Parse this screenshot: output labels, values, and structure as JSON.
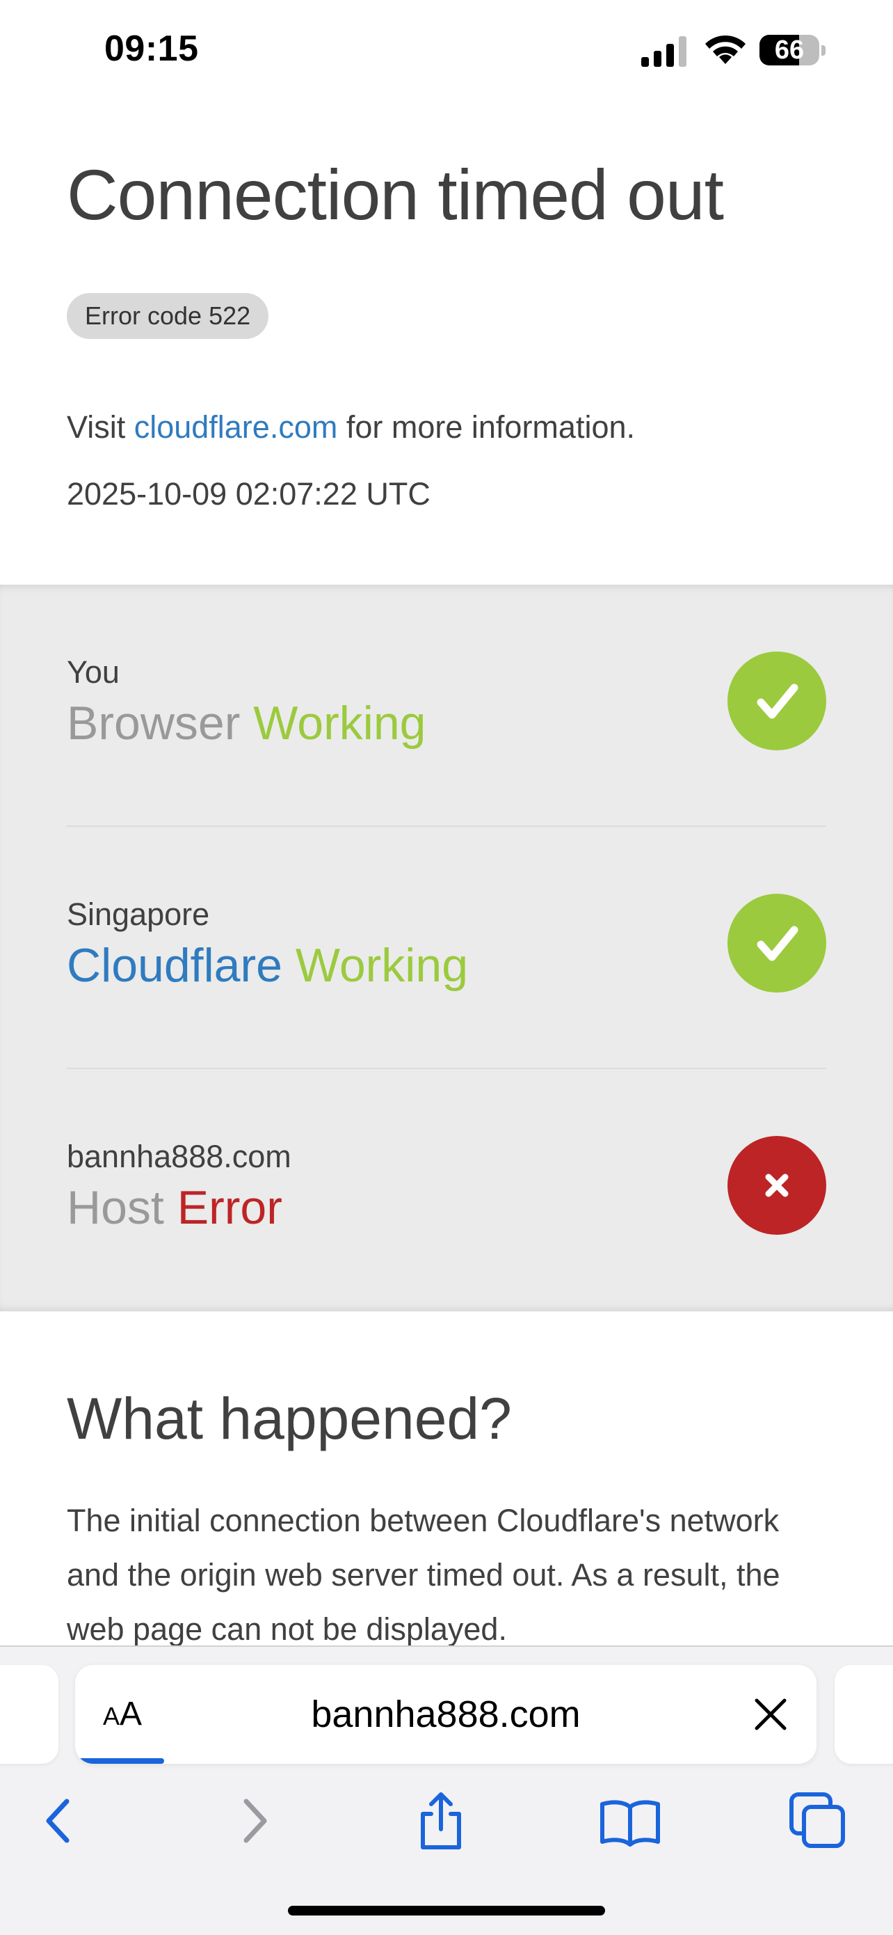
{
  "status_bar": {
    "time": "09:15",
    "battery_level": "66",
    "battery_fraction": 0.66
  },
  "header": {
    "title": "Connection timed out",
    "error_badge": "Error code 522",
    "visit_prefix": "Visit ",
    "visit_link": "cloudflare.com",
    "visit_suffix": " for more information.",
    "timestamp": "2025-10-09 02:07:22 UTC"
  },
  "status_rows": [
    {
      "location": "You",
      "name": "Browser",
      "status": "Working",
      "state": "ok"
    },
    {
      "location": "Singapore",
      "name": "Cloudflare",
      "status": "Working",
      "state": "ok"
    },
    {
      "location": "bannha888.com",
      "name": "Host",
      "status": "Error",
      "state": "error"
    }
  ],
  "what_happened": {
    "title": "What happened?",
    "text": "The initial connection between Cloudflare's network and the origin web server timed out. As a result, the web page can not be displayed."
  },
  "safari": {
    "aa_label_small": "A",
    "aa_label_large": "A",
    "url": "bannha888.com",
    "load_progress": 0.12
  },
  "icons": {
    "signal": "cellular-signal-icon",
    "wifi": "wifi-icon",
    "ok": "checkmark-icon",
    "error": "x-mark-icon",
    "back": "chevron-left-icon",
    "forward": "chevron-right-icon",
    "share": "share-icon",
    "bookmarks": "book-icon",
    "tabs": "tabs-icon"
  },
  "colors": {
    "ok": "#9bca3e",
    "error": "#bd2426",
    "link": "#2f7bbf",
    "panel": "#ebebeb",
    "ios_blue": "#1a64dc"
  }
}
